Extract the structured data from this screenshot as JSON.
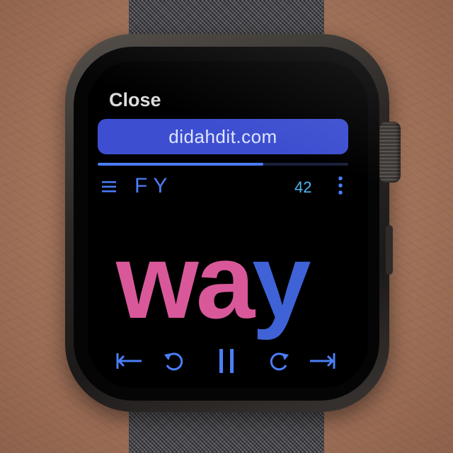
{
  "app": {
    "close_label": "Close",
    "url": "didahdit.com",
    "font_label": "FY",
    "wpm": "42",
    "progress": 0.66,
    "current_word": {
      "lead": "wa",
      "tail": "y"
    }
  },
  "colors": {
    "accent": "#3d4fd0",
    "word_lead": "#d9589a",
    "word_tail": "#3f63d6",
    "control_blue": "#4a7ef7",
    "wpm_cyan": "#4fb6f0"
  },
  "icons": {
    "menu": "hamburger-menu-icon",
    "more": "vertical-ellipsis-icon",
    "skip_back": "skip-to-start-icon",
    "rewind": "rewind-icon",
    "pause": "pause-icon",
    "forward": "forward-icon",
    "skip_forward": "skip-to-end-icon"
  }
}
